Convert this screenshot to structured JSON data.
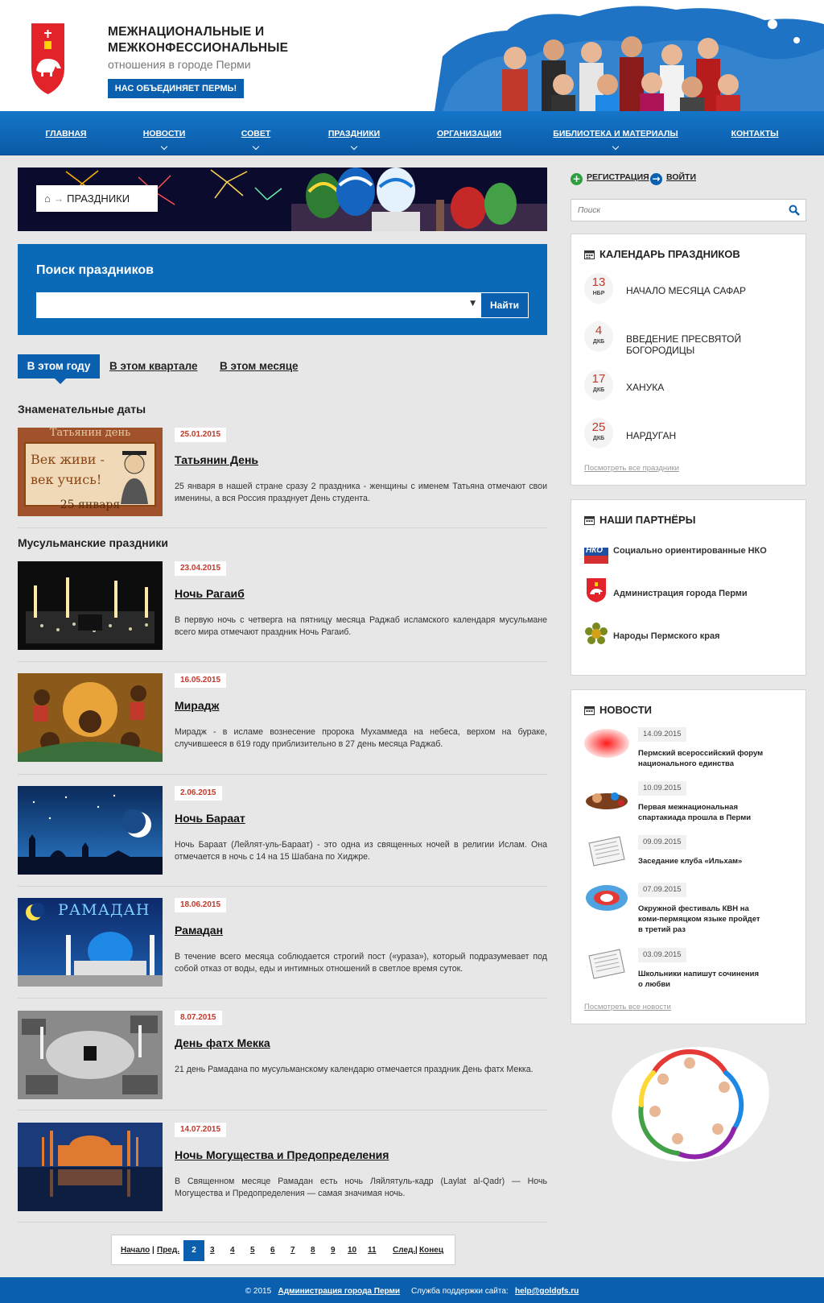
{
  "header": {
    "title_line1": "МЕЖНАЦИОНАЛЬНЫЕ И",
    "title_line2": "МЕЖКОНФЕССИОНАЛЬНЫЕ",
    "subtitle": "отношения в городе Перми",
    "slogan_button": "НАС ОБЪЕДИНЯЕТ ПЕРМЬ!"
  },
  "nav": {
    "items": [
      {
        "label": "ГЛАВНАЯ",
        "has_dropdown": false
      },
      {
        "label": "НОВОСТИ",
        "has_dropdown": true
      },
      {
        "label": "СОВЕТ",
        "has_dropdown": true
      },
      {
        "label": "ПРАЗДНИКИ",
        "has_dropdown": true
      },
      {
        "label": "ОРГАНИЗАЦИИ",
        "has_dropdown": false
      },
      {
        "label": "БИБЛИОТЕКА И МАТЕРИАЛЫ",
        "has_dropdown": true
      },
      {
        "label": "КОНТАКТЫ",
        "has_dropdown": false
      }
    ]
  },
  "breadcrumb": {
    "icon": "home-icon",
    "label": "ПРАЗДНИКИ"
  },
  "search": {
    "title": "Поиск праздников",
    "select_value": "",
    "button": "Найти"
  },
  "tabs": [
    {
      "label": "В этом году",
      "active": true
    },
    {
      "label": "В этом квартале",
      "active": false
    },
    {
      "label": "В этом месяце",
      "active": false
    }
  ],
  "sections": [
    {
      "heading": "Знаменательные даты"
    },
    {
      "heading": "Мусульманские праздники"
    }
  ],
  "items": [
    {
      "date": "25.01.2015",
      "title": "Татьянин День",
      "desc": "25 января в нашей стране сразу 2 праздника - женщины с именем Татьяна отмечают свои именины, а вся Россия празднует День студента.",
      "img": {
        "top": "Татьянин день",
        "line1": "Век живи -",
        "line2": "век учись!",
        "bottom": "25 января"
      }
    },
    {
      "date": "23.04.2015",
      "title": "Ночь Рагаиб",
      "desc": "В первую ночь с четверга на пятницу месяца Раджаб исламского календаря мусульмане всего мира отмечают праздник Ночь Рагаиб."
    },
    {
      "date": "16.05.2015",
      "title": "Мирадж",
      "desc": "Мирадж - в исламе вознесение пророка Мухаммеда на небеса, верхом на бураке, случившееся в 619 году приблизительно в 27 день месяца Раджаб."
    },
    {
      "date": "2.06.2015",
      "title": "Ночь Бараат",
      "desc": "Ночь Бараат (Лейлят-уль-Бараат) - это одна из священных ночей в религии Ислам. Она отмечается в ночь с 14 на 15 Шабана по Хиджре."
    },
    {
      "date": "18.06.2015",
      "title": "Рамадан",
      "desc": "В течение всего месяца соблюдается строгий пост («ураза»), который подразумевает под собой отказ от воды, еды и интимных отношений в светлое время суток.",
      "img": {
        "caption": "РАМАДАН"
      }
    },
    {
      "date": "8.07.2015",
      "title": "День фатх Мекка",
      "desc": "21 день Рамадана по мусульманскому календарю отмечается праздник День фатх Мекка."
    },
    {
      "date": "14.07.2015",
      "title": "Ночь Могущества и Предопределения",
      "desc": "В Священном месяце Рамадан есть ночь Ляйлятуль-кадр (Laylat al-Qadr) — Ночь Могущества и Предопределения — самая значимая ночь."
    }
  ],
  "pager": {
    "first": "Начало",
    "prev": "Пред.",
    "current": "2",
    "pages": [
      "3",
      "4",
      "5",
      "6",
      "7",
      "8",
      "9",
      "10",
      "11"
    ],
    "next": "След.",
    "last": "Конец",
    "sep": "|"
  },
  "footer": {
    "copyright": "© 2015",
    "admin_link": "Администрация города Перми",
    "support_label": "Служба поддержки сайта:",
    "email": "help@goldgfs.ru"
  },
  "auth": {
    "register": "РЕГИСТРАЦИЯ",
    "login": "ВОЙТИ"
  },
  "side_search": {
    "placeholder": "Поиск"
  },
  "calendar": {
    "title": "КАЛЕНДАРЬ ПРАЗДНИКОВ",
    "events": [
      {
        "day": "13",
        "month": "НБР",
        "name": "НАЧАЛО МЕСЯЦА САФАР"
      },
      {
        "day": "4",
        "month": "ДКБ",
        "name": "ВВЕДЕНИЕ ПРЕСВЯТОЙ БОГОРОДИЦЫ"
      },
      {
        "day": "17",
        "month": "ДКБ",
        "name": "ХАНУКА"
      },
      {
        "day": "25",
        "month": "ДКБ",
        "name": "НАРДУГАН"
      }
    ],
    "more": "Посмотреть все праздники"
  },
  "partners": {
    "title": "НАШИ ПАРТНЁРЫ",
    "items": [
      {
        "name": "Социально ориентированные НКО",
        "logo_text": "НКО"
      },
      {
        "name": "Администрация города Перми"
      },
      {
        "name": "Народы Пермского края"
      }
    ]
  },
  "news": {
    "title": "НОВОСТИ",
    "items": [
      {
        "date": "14.09.2015",
        "title_lines": [
          "Пермский всероссийский форум",
          "национального единства"
        ]
      },
      {
        "date": "10.09.2015",
        "title_lines": [
          "Первая межнациональная",
          "спартакиада прошла в Перми"
        ]
      },
      {
        "date": "09.09.2015",
        "title_lines": [
          "Заседание клуба «Ильхам»"
        ]
      },
      {
        "date": "07.09.2015",
        "title_lines": [
          "Окружной фестиваль КВН на",
          "коми-пермяцком языке пройдет",
          "в третий раз"
        ]
      },
      {
        "date": "03.09.2015",
        "title_lines": [
          "Школьники напишут сочинения",
          "о любви"
        ]
      }
    ],
    "more": "Посмотреть все новости"
  },
  "colors": {
    "primary_blue": "#0a5fae",
    "accent_red": "#c0392b",
    "page_bg": "#e7e7e7"
  }
}
